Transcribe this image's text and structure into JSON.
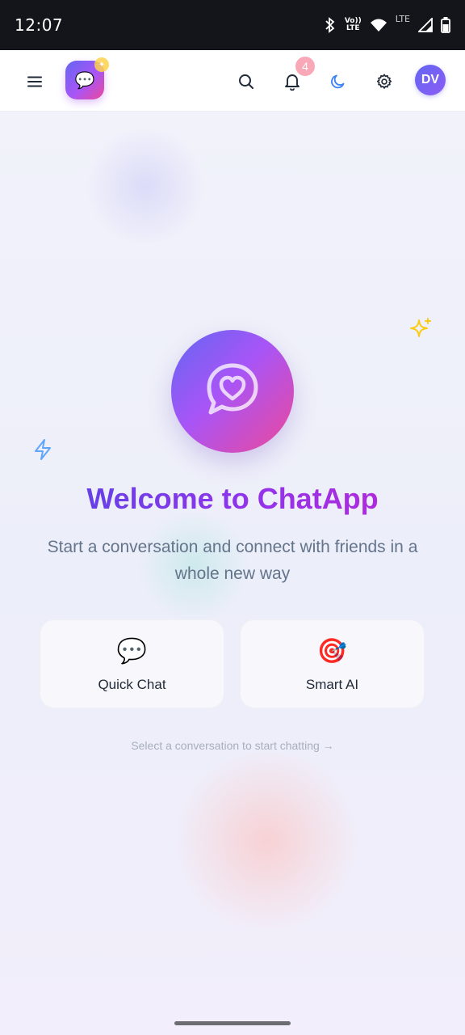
{
  "status_bar": {
    "time": "12:07",
    "volte_line1": "Vo))",
    "volte_line2": "LTE",
    "lte": "LTE",
    "icons": [
      "bluetooth-icon",
      "volte-icon",
      "wifi-icon",
      "signal-icon",
      "battery-icon"
    ]
  },
  "header": {
    "menu_icon": "hamburger-menu-icon",
    "logo_icon": "speech-bubble-emoji",
    "logo_glyph": "💬",
    "logo_badge_glyph": "✦",
    "search_icon": "search-icon",
    "notifications": {
      "icon": "bell-icon",
      "count": "4"
    },
    "theme_icon": "moon-icon",
    "settings_icon": "gear-icon",
    "avatar_initials": "DV"
  },
  "main": {
    "hero_icon": "heart-chat-icon",
    "title": "Welcome to ChatApp",
    "subtitle": "Start a conversation and connect with friends in a whole new way",
    "cards": [
      {
        "icon": "speech-bubble-emoji",
        "glyph": "💬",
        "label": "Quick Chat"
      },
      {
        "icon": "target-emoji",
        "glyph": "🎯",
        "label": "Smart AI"
      }
    ],
    "hint": "Select a conversation to start chatting →"
  },
  "colors": {
    "accent_indigo": "#6366f1",
    "accent_purple": "#a855f7",
    "accent_pink": "#ec4899",
    "sparkle": "#facc15",
    "bolt": "#60a5fa",
    "badge": "#f9a8b8"
  }
}
